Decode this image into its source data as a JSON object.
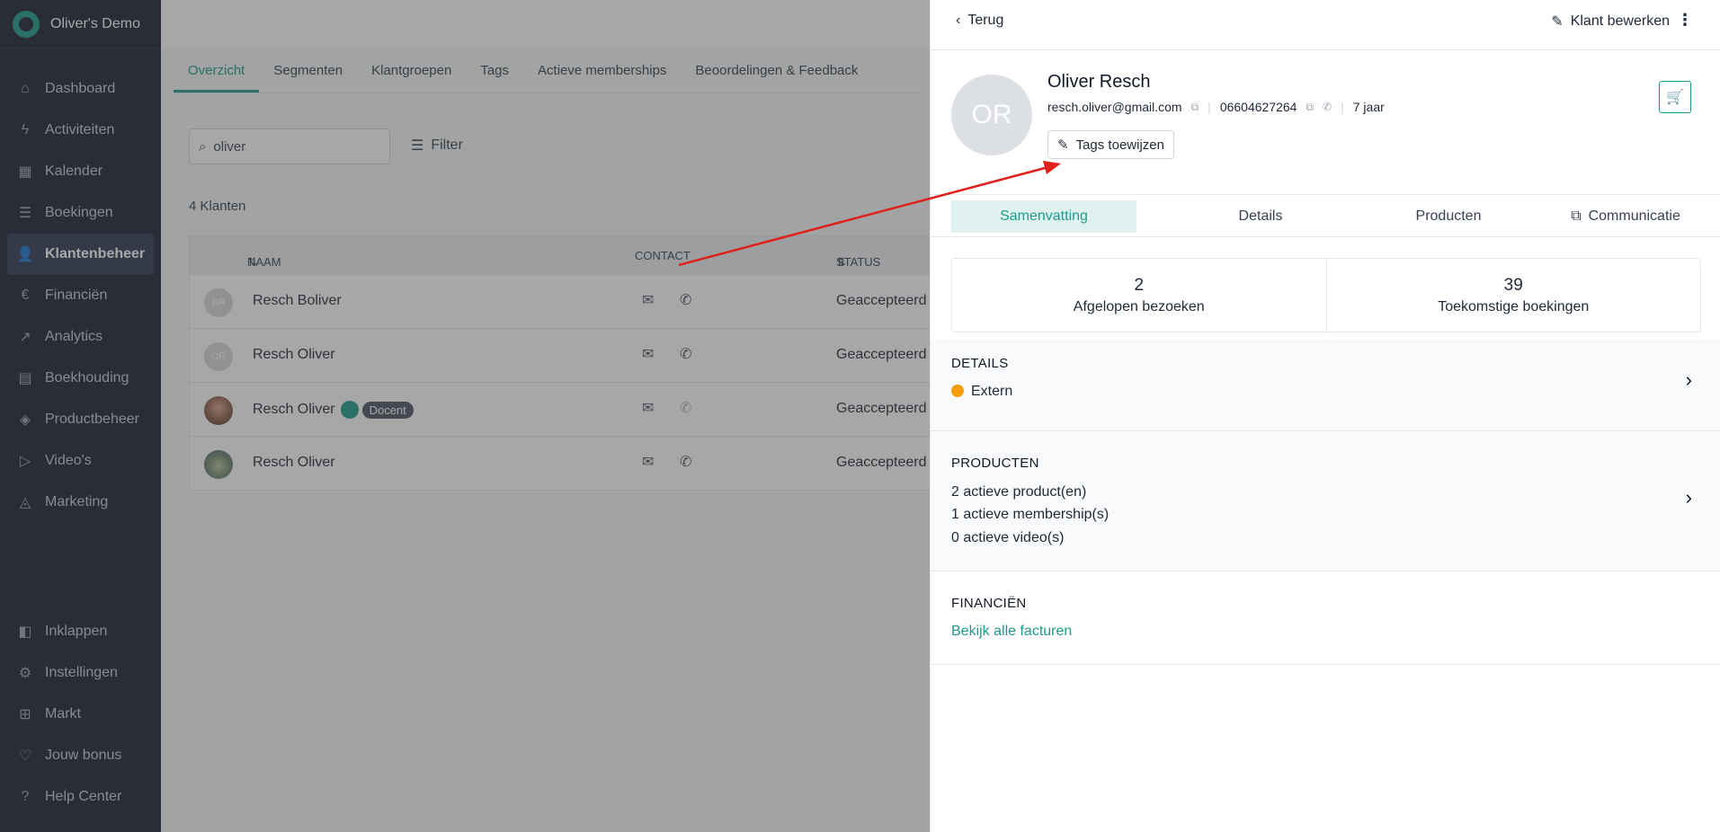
{
  "app": {
    "title": "Oliver's Demo"
  },
  "sidebar": {
    "items": [
      {
        "label": "Dashboard",
        "icon": "home-icon"
      },
      {
        "label": "Activiteiten",
        "icon": "bolt-icon"
      },
      {
        "label": "Kalender",
        "icon": "calendar-icon"
      },
      {
        "label": "Boekingen",
        "icon": "list-icon"
      },
      {
        "label": "Klantenbeheer",
        "icon": "user-icon"
      },
      {
        "label": "Financiën",
        "icon": "euro-icon"
      },
      {
        "label": "Analytics",
        "icon": "chart-icon"
      },
      {
        "label": "Boekhouding",
        "icon": "clipboard-icon"
      },
      {
        "label": "Productbeheer",
        "icon": "box-icon"
      },
      {
        "label": "Video's",
        "icon": "play-icon"
      },
      {
        "label": "Marketing",
        "icon": "megaphone-icon"
      }
    ],
    "bottom_items": [
      {
        "label": "Inklappen",
        "icon": "collapse-icon"
      },
      {
        "label": "Instellingen",
        "icon": "gear-icon"
      },
      {
        "label": "Markt",
        "icon": "plus-square-icon"
      },
      {
        "label": "Jouw bonus",
        "icon": "heart-icon"
      },
      {
        "label": "Help Center",
        "icon": "help-icon"
      }
    ]
  },
  "main": {
    "tabs": [
      "Overzicht",
      "Segmenten",
      "Klantgroepen",
      "Tags",
      "Actieve memberships",
      "Beoordelingen & Feedback"
    ],
    "search_value": "oliver",
    "filter_label": "Filter",
    "count_label": "4 Klanten",
    "columns": {
      "name": "NAAM",
      "contact": "CONTACT",
      "status": "STATUS"
    },
    "rows": [
      {
        "initials": "BR",
        "name": "Resch Boliver",
        "status": "Geaccepteerd"
      },
      {
        "initials": "OR",
        "name": "Resch Oliver",
        "status": "Geaccepteerd"
      },
      {
        "initials": "",
        "name": "Resch Oliver",
        "status": "Geaccepteerd",
        "badge": "Docent"
      },
      {
        "initials": "",
        "name": "Resch Oliver",
        "status": "Geaccepteerd"
      }
    ]
  },
  "panel": {
    "back_label": "Terug",
    "edit_label": "Klant bewerken",
    "initials": "OR",
    "name": "Oliver Resch",
    "email": "resch.oliver@gmail.com",
    "phone": "06604627264",
    "age": "7 jaar",
    "tags_button": "Tags toewijzen",
    "tabs": [
      "Samenvatting",
      "Details",
      "Producten",
      "Communicatie"
    ],
    "stats": [
      {
        "value": "2",
        "label": "Afgelopen bezoeken"
      },
      {
        "value": "39",
        "label": "Toekomstige boekingen"
      }
    ],
    "details": {
      "title": "DETAILS",
      "value": "Extern"
    },
    "producten": {
      "title": "PRODUCTEN",
      "lines": [
        "2 actieve product(en)",
        "1 actieve membership(s)",
        "0 actieve video(s)"
      ]
    },
    "financien": {
      "title": "FINANCIËN",
      "link": "Bekijk alle facturen"
    }
  },
  "colors": {
    "accent": "#1d9b8a",
    "sidebar": "#1a2234",
    "annotation_arrow": "#e0201a",
    "status_dot": "#f59e0b"
  }
}
